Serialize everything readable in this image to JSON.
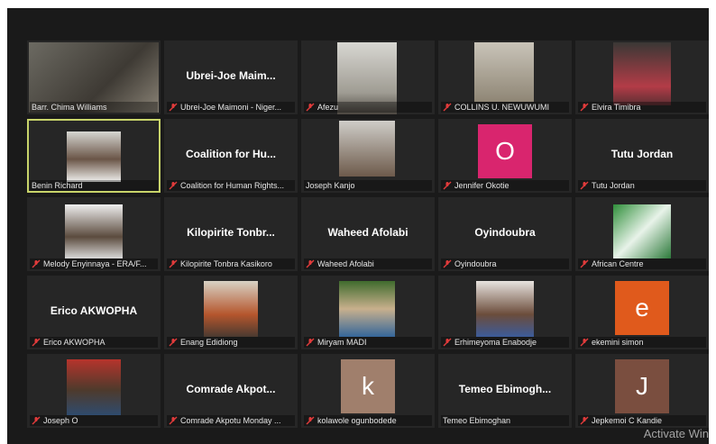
{
  "participants": [
    {
      "label": "Barr. Chima Williams",
      "center_name": "",
      "muted": false,
      "avatar_letter": "",
      "avatar_color": "",
      "has_video": true
    },
    {
      "label": "Ubrei-Joe Maimoni - Niger...",
      "center_name": "Ubrei-Joe Maim...",
      "muted": true,
      "avatar_letter": "",
      "avatar_color": "",
      "has_video": false
    },
    {
      "label": "Afezu",
      "center_name": "",
      "muted": true,
      "avatar_letter": "",
      "avatar_color": "",
      "has_video": true
    },
    {
      "label": "COLLINS U. NEWUWUMI",
      "center_name": "",
      "muted": true,
      "avatar_letter": "",
      "avatar_color": "",
      "has_video": true
    },
    {
      "label": "Elvira Timibra",
      "center_name": "",
      "muted": true,
      "avatar_letter": "",
      "avatar_color": "",
      "has_video": true
    },
    {
      "label": "Benin Richard",
      "center_name": "",
      "muted": false,
      "avatar_letter": "",
      "avatar_color": "",
      "has_video": true,
      "active_speaker": true
    },
    {
      "label": "Coalition for Human Rights...",
      "center_name": "Coalition for Hu...",
      "muted": true,
      "avatar_letter": "",
      "avatar_color": "",
      "has_video": false
    },
    {
      "label": "Joseph Kanjo",
      "center_name": "",
      "muted": false,
      "avatar_letter": "",
      "avatar_color": "",
      "has_video": true
    },
    {
      "label": "Jennifer Okotie",
      "center_name": "",
      "muted": true,
      "avatar_letter": "O",
      "avatar_color": "#d9256e",
      "has_video": false
    },
    {
      "label": "Tutu Jordan",
      "center_name": "Tutu Jordan",
      "muted": true,
      "avatar_letter": "",
      "avatar_color": "",
      "has_video": false
    },
    {
      "label": "Melody Enyinnaya - ERA/F...",
      "center_name": "",
      "muted": true,
      "avatar_letter": "",
      "avatar_color": "",
      "has_video": true
    },
    {
      "label": "Kilopirite Tonbra Kasikoro",
      "center_name": "Kilopirite Tonbr...",
      "muted": true,
      "avatar_letter": "",
      "avatar_color": "",
      "has_video": false
    },
    {
      "label": "Waheed Afolabi",
      "center_name": "Waheed Afolabi",
      "muted": true,
      "avatar_letter": "",
      "avatar_color": "",
      "has_video": false
    },
    {
      "label": "Oyindoubra",
      "center_name": "Oyindoubra",
      "muted": true,
      "avatar_letter": "",
      "avatar_color": "",
      "has_video": false
    },
    {
      "label": "African Centre",
      "center_name": "",
      "muted": true,
      "avatar_letter": "",
      "avatar_color": "",
      "has_video": true
    },
    {
      "label": "Erico AKWOPHA",
      "center_name": "Erico AKWOPHA",
      "muted": true,
      "avatar_letter": "",
      "avatar_color": "",
      "has_video": false
    },
    {
      "label": "Enang Edidiong",
      "center_name": "",
      "muted": true,
      "avatar_letter": "",
      "avatar_color": "",
      "has_video": true
    },
    {
      "label": "Miryam MADI",
      "center_name": "",
      "muted": true,
      "avatar_letter": "",
      "avatar_color": "",
      "has_video": true
    },
    {
      "label": "Erhimeyoma Enabodje",
      "center_name": "",
      "muted": true,
      "avatar_letter": "",
      "avatar_color": "",
      "has_video": true
    },
    {
      "label": "ekemini simon",
      "center_name": "",
      "muted": true,
      "avatar_letter": "e",
      "avatar_color": "#e05a1c",
      "has_video": false
    },
    {
      "label": "Joseph O",
      "center_name": "",
      "muted": true,
      "avatar_letter": "",
      "avatar_color": "",
      "has_video": true
    },
    {
      "label": "Comrade Akpotu Monday ...",
      "center_name": "Comrade Akpot...",
      "muted": true,
      "avatar_letter": "",
      "avatar_color": "",
      "has_video": false
    },
    {
      "label": "kolawole ogunbodede",
      "center_name": "",
      "muted": true,
      "avatar_letter": "k",
      "avatar_color": "#a07f6c",
      "has_video": false
    },
    {
      "label": "Temeo Ebimoghan",
      "center_name": "Temeo Ebimogh...",
      "muted": false,
      "avatar_letter": "",
      "avatar_color": "",
      "has_video": false
    },
    {
      "label": "Jepkemoi C Kandie",
      "center_name": "",
      "muted": true,
      "avatar_letter": "J",
      "avatar_color": "#7a4e3f",
      "has_video": false
    }
  ],
  "watermark": "Activate Win",
  "colors": {
    "mic_muted": "#e23b3b",
    "active_border": "#c8d46a"
  }
}
